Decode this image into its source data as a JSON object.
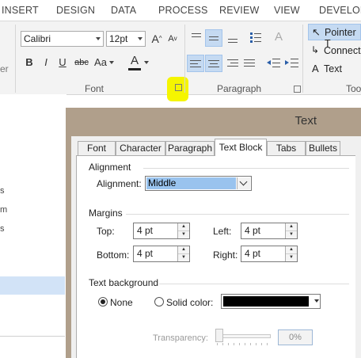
{
  "ribbon_tabs": [
    "INSERT",
    "DESIGN",
    "DATA",
    "PROCESS",
    "REVIEW",
    "VIEW",
    "DEVELOPE"
  ],
  "font_group": {
    "font_name": "Calibri",
    "font_size": "12pt",
    "label": "Font",
    "bold": "B",
    "italic": "I",
    "underline": "U",
    "strike": "abc",
    "change_case": "Aa",
    "font_color": "A",
    "grow": "A",
    "shrink": "A"
  },
  "paragraph_group": {
    "label": "Paragraph"
  },
  "tools_group": {
    "pointer_tool": "Pointer T",
    "connector": "Connect",
    "text": "Text",
    "label": "Too"
  },
  "left_pane": {
    "left_cut_label": "er",
    "items": [
      "s",
      "m",
      "s"
    ]
  },
  "dialog": {
    "title": "Text",
    "tabs": [
      "Font",
      "Character",
      "Paragraph",
      "Text Block",
      "Tabs",
      "Bullets"
    ],
    "active_tab": "Text Block",
    "alignment": {
      "section": "Alignment",
      "label": "Alignment:",
      "value": "Middle"
    },
    "margins": {
      "section": "Margins",
      "top_label": "Top:",
      "top": "4 pt",
      "left_label": "Left:",
      "left": "4 pt",
      "bottom_label": "Bottom:",
      "bottom": "4 pt",
      "right_label": "Right:",
      "right": "4 pt"
    },
    "background": {
      "section": "Text background",
      "none_label": "None",
      "solid_label": "Solid color:",
      "selected": "None",
      "color": "#000000",
      "transparency_label": "Transparency:",
      "transparency_value": "0%"
    }
  },
  "colors": {
    "highlight": "#f5f500",
    "selection": "#c5daf2",
    "dialog_frame": "#b09f8b"
  }
}
